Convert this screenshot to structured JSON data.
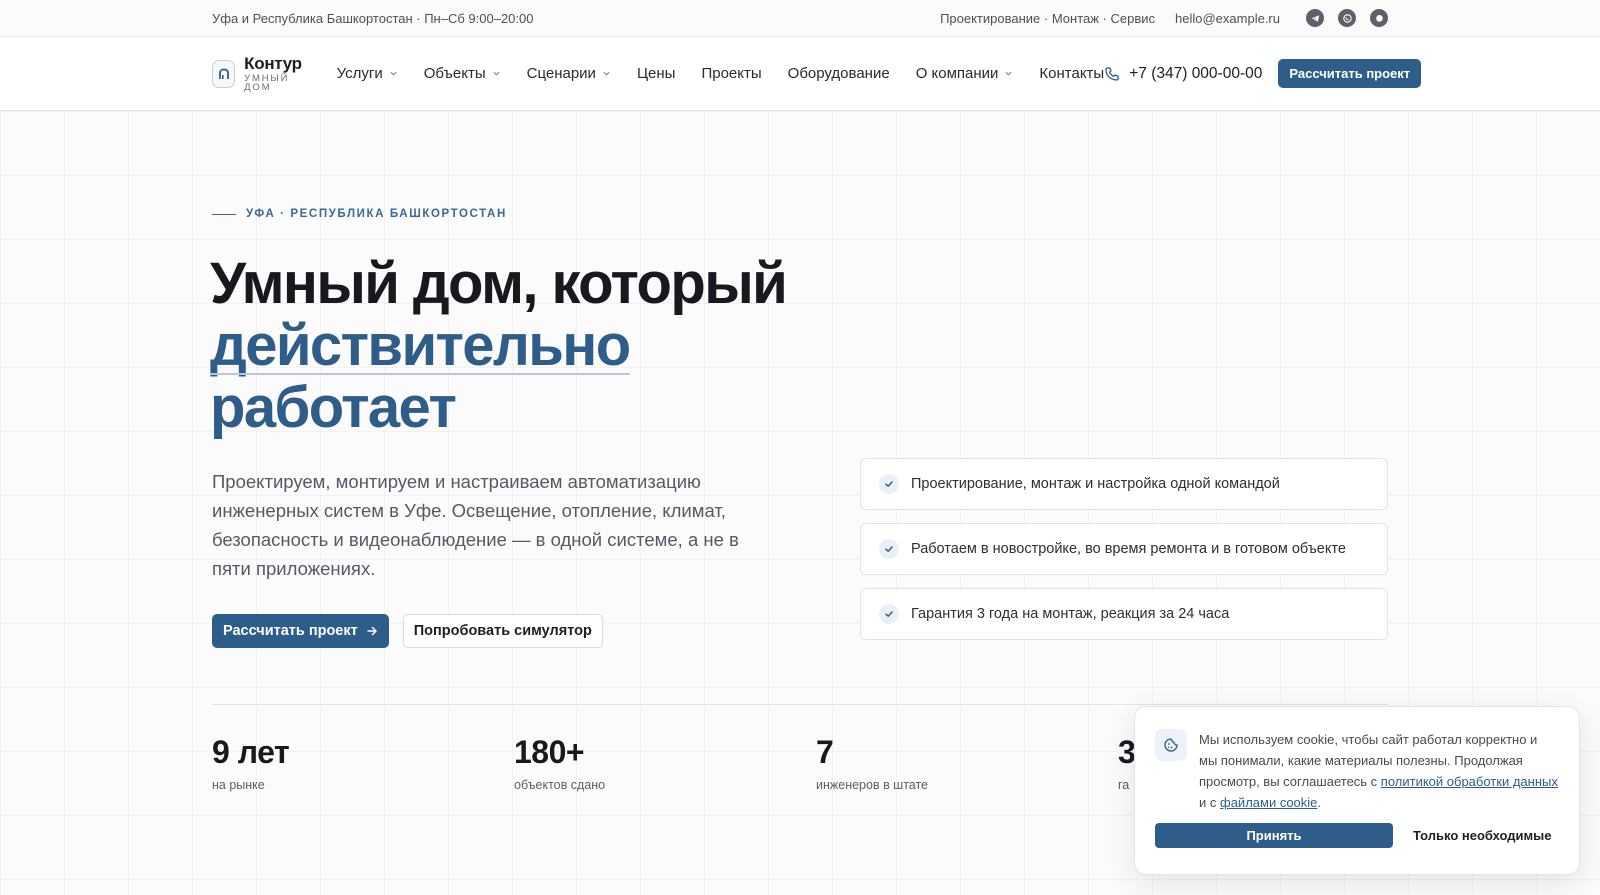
{
  "topbar": {
    "location_hours": "Уфа и Республика Башкортостан · Пн–Сб 9:00–20:00",
    "services": "Проектирование · Монтаж · Сервис",
    "email": "hello@example.ru",
    "socials": [
      "telegram-icon",
      "whatsapp-icon",
      "chat-icon"
    ]
  },
  "header": {
    "logo_name": "Контур",
    "logo_sub": "УМНЫЙ ДОМ",
    "nav": [
      {
        "label": "Услуги",
        "dropdown": true
      },
      {
        "label": "Объекты",
        "dropdown": true
      },
      {
        "label": "Сценарии",
        "dropdown": true
      },
      {
        "label": "Цены",
        "dropdown": false
      },
      {
        "label": "Проекты",
        "dropdown": false
      },
      {
        "label": "Оборудование",
        "dropdown": false
      },
      {
        "label": "О компании",
        "dropdown": true
      },
      {
        "label": "Контакты",
        "dropdown": false
      }
    ],
    "phone": "+7 (347) 000-00-00",
    "cta": "Рассчитать проект"
  },
  "hero": {
    "eyebrow": "УФА · РЕСПУБЛИКА БАШКОРТОСТАН",
    "title_line1": "Умный дом, который",
    "title_accent1": "действительно",
    "title_accent2": "работает",
    "lead": "Проектируем, монтируем и настраиваем автоматизацию инженерных систем в Уфе. Освещение, отопление, климат, безопасность и видеонаблюдение — в одной системе, а не в пяти приложениях.",
    "cta_primary": "Рассчитать проект",
    "cta_secondary": "Попробовать симулятор",
    "features": [
      "Проектирование, монтаж и настройка одной командой",
      "Работаем в новостройке, во время ремонта и в готовом объекте",
      "Гарантия 3 года на монтаж, реакция за 24 часа"
    ]
  },
  "stats": [
    {
      "value": "9 лет",
      "label": "на рынке"
    },
    {
      "value": "180+",
      "label": "объектов сдано"
    },
    {
      "value": "7",
      "label": "инженеров в штате"
    },
    {
      "value": "3",
      "label": "га"
    }
  ],
  "cookie": {
    "text_before": "Мы используем cookie, чтобы сайт работал корректно и мы понимали, какие материалы полезны. Продолжая просмотр, вы соглашаетесь с ",
    "link_policy": "политикой обработки данных",
    "text_middle": " и с ",
    "link_cookies": "файлами cookie",
    "text_end": ".",
    "accept": "Принять",
    "necessary": "Только необходимые"
  },
  "colors": {
    "accent": "#2f5d8a",
    "text": "#17191e",
    "muted": "#545a65"
  }
}
